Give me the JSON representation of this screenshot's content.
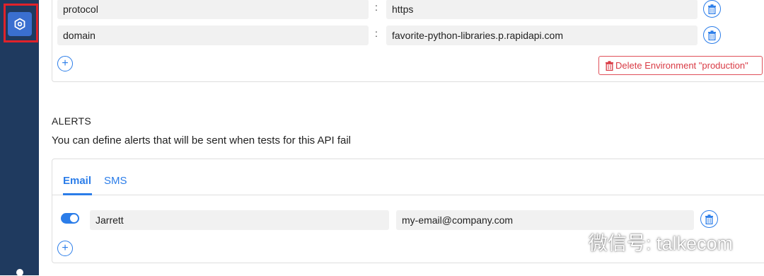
{
  "environment": {
    "variables": [
      {
        "key": "protocol",
        "value": "https"
      },
      {
        "key": "domain",
        "value": "favorite-python-libraries.p.rapidapi.com"
      }
    ],
    "separator": ":",
    "delete_label": "Delete Environment \"production\""
  },
  "alerts": {
    "title": "ALERTS",
    "description": "You can define alerts that will be sent when tests for this API fail",
    "tabs": [
      {
        "label": "Email",
        "active": true
      },
      {
        "label": "SMS",
        "active": false
      }
    ],
    "rows": [
      {
        "enabled": true,
        "name": "Jarrett",
        "email": "my-email@company.com"
      }
    ]
  },
  "watermark": {
    "text": "微信号: talkecom"
  },
  "colors": {
    "sidebar": "#1f3a5f",
    "accent": "#2b7de9",
    "danger": "#d93a44",
    "highlight": "#e0222a"
  },
  "icons": {
    "sidebar": "settings-icon",
    "row_action": "trash-icon",
    "add": "plus-icon",
    "watermark": "wechat-icon"
  }
}
